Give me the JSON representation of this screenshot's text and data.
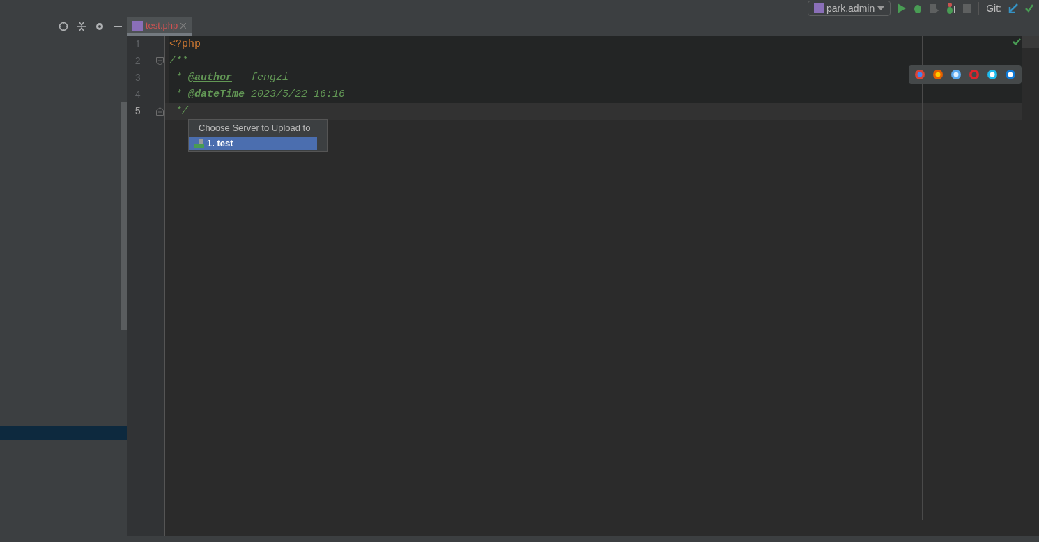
{
  "toolbar": {
    "run_config": "park.admin",
    "vcs_label": "Git:"
  },
  "tabs": [
    {
      "label": "test.php",
      "selected": true
    }
  ],
  "editor": {
    "lines": [
      {
        "number": "1",
        "current": false,
        "kind": "plain",
        "tokens": [
          {
            "kind": "keyword",
            "text": "<?php"
          }
        ]
      },
      {
        "number": "2",
        "current": false,
        "kind": "fold-start",
        "tokens": [
          {
            "kind": "comment",
            "text": "/**"
          }
        ]
      },
      {
        "number": "3",
        "current": false,
        "kind": "plain",
        "tokens": [
          {
            "kind": "comment",
            "text": " * "
          },
          {
            "kind": "tag",
            "text": "@author"
          },
          {
            "kind": "comment",
            "text": "   fengzi"
          }
        ]
      },
      {
        "number": "4",
        "current": false,
        "kind": "plain",
        "tokens": [
          {
            "kind": "comment",
            "text": " * "
          },
          {
            "kind": "tag",
            "text": "@dateTime"
          },
          {
            "kind": "comment",
            "text": " 2023/5/22 16:16"
          }
        ]
      },
      {
        "number": "5",
        "current": true,
        "kind": "fold-end",
        "tokens": [
          {
            "kind": "comment",
            "text": " */"
          }
        ]
      }
    ]
  },
  "popup": {
    "title": "Choose Server to Upload to",
    "items": [
      {
        "label": "1. test",
        "selected": true
      }
    ]
  }
}
